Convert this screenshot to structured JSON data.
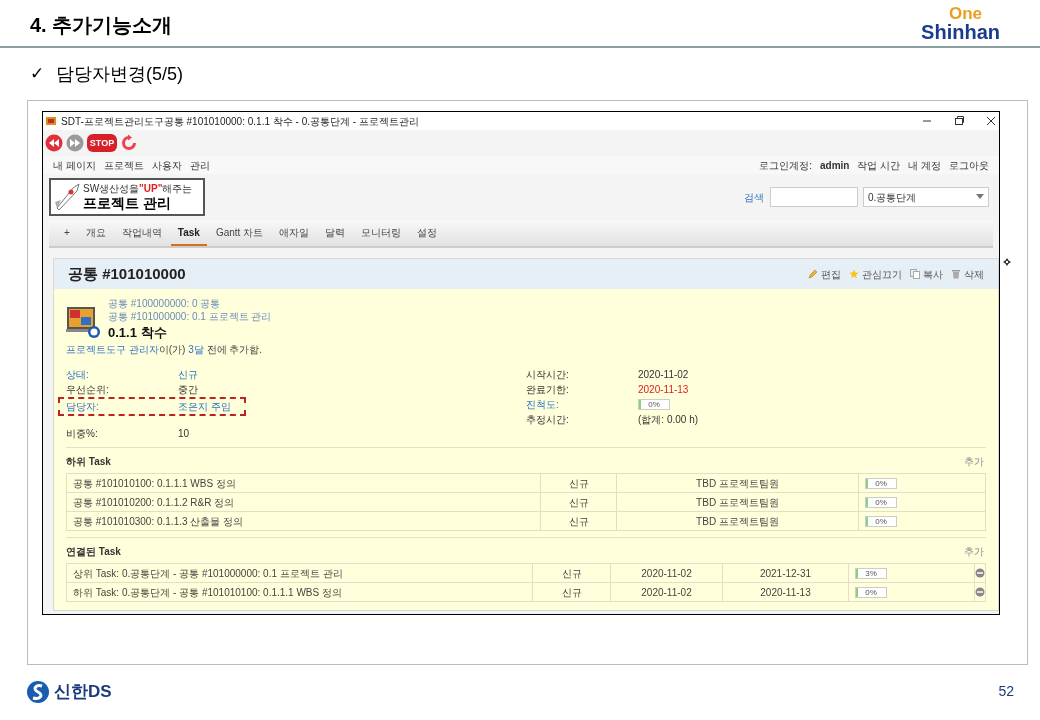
{
  "slide": {
    "section_title": "4. 추가기능소개",
    "brand_top": "One",
    "brand_bottom": "Shinhan",
    "check": "✓",
    "subtitle": "담당자변경(5/5)",
    "footer_brand": "신한DS",
    "page_number": "52"
  },
  "window": {
    "title": "SDT-프로젝트관리도구공통 #101010000: 0.1.1 착수 - 0.공통단계 - 프로젝트관리"
  },
  "toolbar": [
    {
      "kind": "back"
    },
    {
      "kind": "forward"
    },
    {
      "kind": "stop",
      "label": "STOP"
    },
    {
      "kind": "reload"
    }
  ],
  "top_menu": [
    "내 페이지",
    "프로젝트",
    "사용자",
    "관리"
  ],
  "account": {
    "label": "로그인계정:",
    "user": "admin",
    "links": [
      "작업 시간",
      "내 계정",
      "로그아웃"
    ]
  },
  "logo": {
    "tagline_before": "SW생산성을",
    "tagline_highlight": "\"UP\"",
    "tagline_after": "해주는",
    "title": "프로젝트 관리"
  },
  "search": {
    "label": "검색"
  },
  "project_select": {
    "value": "0.공통단계"
  },
  "tabs": [
    {
      "label": "+",
      "selected": false
    },
    {
      "label": "개요",
      "selected": false
    },
    {
      "label": "작업내역",
      "selected": false
    },
    {
      "label": "Task",
      "selected": true
    },
    {
      "label": "Gantt 차트",
      "selected": false
    },
    {
      "label": "애자일",
      "selected": false
    },
    {
      "label": "달력",
      "selected": false
    },
    {
      "label": "모니터링",
      "selected": false
    },
    {
      "label": "설정",
      "selected": false
    }
  ],
  "issue": {
    "heading": "공통 #101010000",
    "actions": [
      {
        "kind": "edit",
        "label": "편집"
      },
      {
        "kind": "watch",
        "label": "관심끄기"
      },
      {
        "kind": "copy",
        "label": "복사"
      },
      {
        "kind": "delete",
        "label": "삭제"
      }
    ],
    "parents": [
      "공통 #100000000: 0 공통",
      "공통 #101000000: 0.1 프로젝트 관리"
    ],
    "subject": "0.1.1 착수",
    "author": {
      "name": "프로젝트도구 관리자",
      "middle": "이(가)",
      "age": "3달",
      "end": "전에 추가함."
    },
    "left_attributes": [
      {
        "label": "상태:",
        "value": "신규",
        "link": true,
        "highlighted": false
      },
      {
        "label": "우선순위:",
        "value": "중간",
        "link": false,
        "highlighted": false
      },
      {
        "label": "담당자:",
        "value": "조은지 주임",
        "link": true,
        "highlighted": true
      },
      {
        "label": "비중%:",
        "value": "10",
        "link": false,
        "highlighted": false
      }
    ],
    "right_attributes": [
      {
        "kind": "text",
        "label": "시작시간:",
        "value": "2020-11-02",
        "link": false,
        "overdue": false
      },
      {
        "kind": "text",
        "label": "완료기한:",
        "value": "2020-11-13",
        "link": false,
        "overdue": true
      },
      {
        "kind": "progress",
        "label": "진척도:",
        "value": "0%",
        "level": 0,
        "link": true
      },
      {
        "kind": "text",
        "label": "추정시간:",
        "value": "(합계: 0.00 h)",
        "link": false,
        "overdue": false
      }
    ]
  },
  "subtasks": {
    "title": "하위 Task",
    "add": "추가",
    "rows": [
      {
        "subject": "공통 #101010100: 0.1.1.1 WBS 정의",
        "status": "신규",
        "assignee": "TBD 프로젝트팀원",
        "progress": "0%",
        "level": 0
      },
      {
        "subject": "공통 #101010200: 0.1.1.2 R&R 정의",
        "status": "신규",
        "assignee": "TBD 프로젝트팀원",
        "progress": "0%",
        "level": 0
      },
      {
        "subject": "공통 #101010300: 0.1.1.3 산출물 정의",
        "status": "신규",
        "assignee": "TBD 프로젝트팀원",
        "progress": "0%",
        "level": 0
      }
    ]
  },
  "relations": {
    "title": "연결된 Task",
    "add": "추가",
    "rows": [
      {
        "subject": "상위 Task: 0.공통단계 - 공통 #101000000: 0.1 프로젝트 관리",
        "status": "신규",
        "start": "2020-11-02",
        "due": "2021-12-31",
        "progress": "3%",
        "level": 0.03
      },
      {
        "subject": "하위 Task: 0.공통단계 - 공통 #101010100: 0.1.1.1 WBS 정의",
        "status": "신규",
        "start": "2020-11-02",
        "due": "2020-11-13",
        "progress": "0%",
        "level": 0
      }
    ]
  }
}
